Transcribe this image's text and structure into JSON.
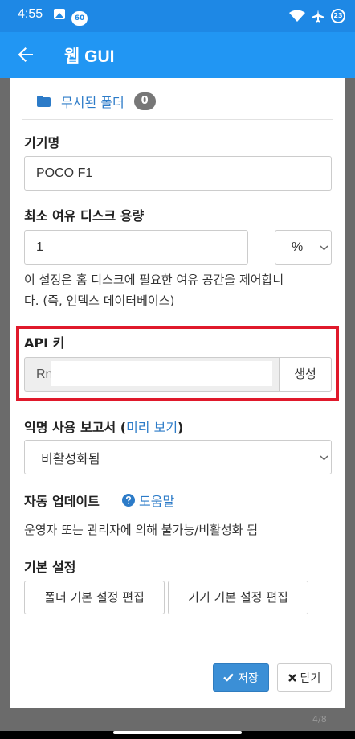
{
  "status_bar": {
    "time": "4:55",
    "notification_count": "60",
    "battery": "23"
  },
  "app_bar": {
    "title": "웹 GUI"
  },
  "dialog": {
    "ignored_folders": {
      "label": "무시된 폴더",
      "count": "0"
    },
    "device_name": {
      "label": "기기명",
      "value": "POCO F1"
    },
    "min_disk_space": {
      "label": "최소 여유 디스크 용량",
      "value": "1",
      "unit": "%",
      "help_line1": "이 설정은 홈 디스크에 필요한 여유 공간을 제어합니",
      "help_line2": "다. (즉, 인덱스 데이터베이스)"
    },
    "api_key": {
      "label": "API 키",
      "value_visible": "Rn",
      "generate_label": "생성"
    },
    "usage_reporting": {
      "label": "익명 사용 보고서 (",
      "preview_link": "미리 보기",
      "label_end": ")",
      "selected": "비활성화됨"
    },
    "auto_update": {
      "label": "자동 업데이트",
      "help_link": "도움말",
      "status": "운영자 또는 관리자에 의해 불가능/비활성화 됨"
    },
    "defaults": {
      "label": "기본 설정",
      "edit_folder_defaults": "폴더 기본 설정 편집",
      "edit_device_defaults": "기기 기본 설정 편집"
    },
    "footer": {
      "save": "저장",
      "close": "닫기"
    }
  },
  "background_peek": "4/8",
  "colors": {
    "primary": "#2196f3",
    "status_bar": "#1e88e5",
    "link": "#2c7bc8",
    "highlight": "#e0192b",
    "save_button": "#3b8fd6"
  }
}
